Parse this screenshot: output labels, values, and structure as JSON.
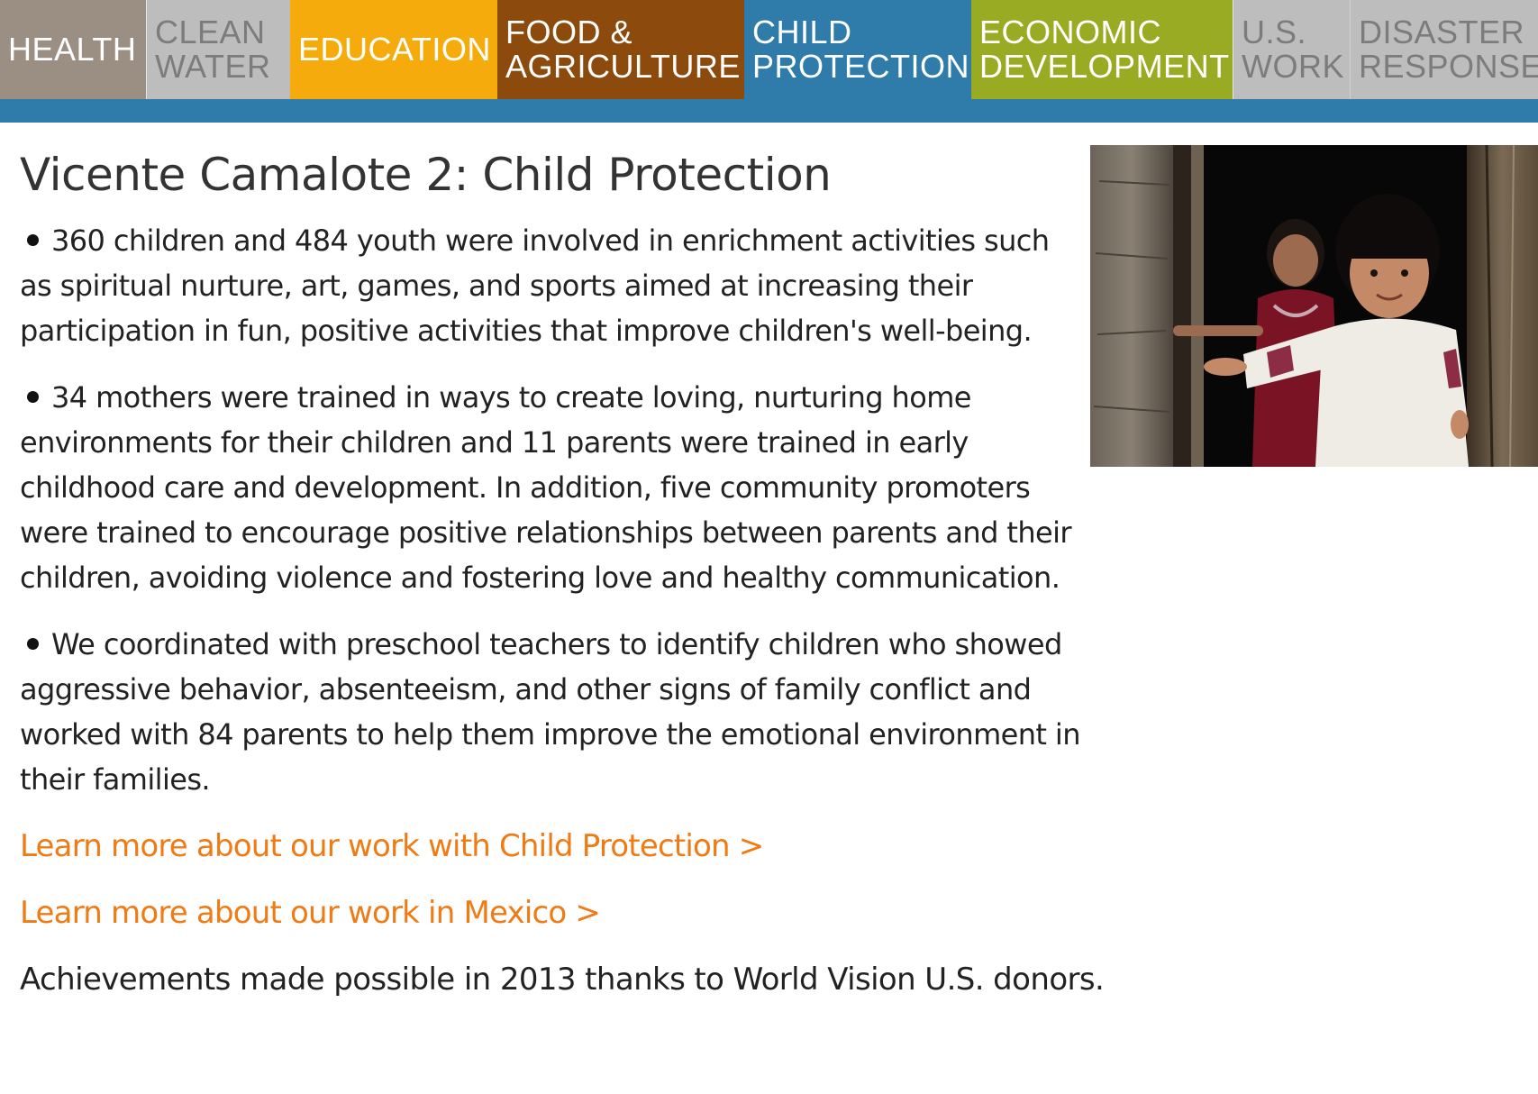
{
  "nav": {
    "tabs": [
      {
        "id": "health",
        "lines": [
          "HEALTH"
        ],
        "bg": "#9b8f83",
        "fg": "#ffffff"
      },
      {
        "id": "water",
        "lines": [
          "CLEAN",
          "WATER"
        ],
        "bg": "#bdbdbd",
        "fg": "#7c7c7c"
      },
      {
        "id": "education",
        "lines": [
          "EDUCATION"
        ],
        "bg": "#f6ab0c",
        "fg": "#ffffff"
      },
      {
        "id": "food",
        "lines": [
          "FOOD &",
          "AGRICULTURE"
        ],
        "bg": "#8c4a0d",
        "fg": "#ffffff"
      },
      {
        "id": "child",
        "lines": [
          "CHILD",
          "PROTECTION"
        ],
        "bg": "#2f7cab",
        "fg": "#ffffff"
      },
      {
        "id": "economic",
        "lines": [
          "ECONOMIC",
          "DEVELOPMENT"
        ],
        "bg": "#99ab23",
        "fg": "#ffffff"
      },
      {
        "id": "us",
        "lines": [
          "U.S.",
          "WORK"
        ],
        "bg": "#bdbdbd",
        "fg": "#7c7c7c"
      },
      {
        "id": "disaster",
        "lines": [
          "DISASTER",
          "RESPONSE"
        ],
        "bg": "#bdbdbd",
        "fg": "#7c7c7c"
      }
    ]
  },
  "colors": {
    "accent_bar": "#2f7cab",
    "link": "#f07b14",
    "text": "#222222"
  },
  "main": {
    "title": "Vicente Camalote 2: Child Protection",
    "paragraphs": [
      "360 children and 484 youth were involved in enrichment activities such as spiritual nurture, art, games, and sports aimed at increasing their participation in fun, positive activities that improve children's well-being.",
      "34 mothers were trained in ways to create loving, nurturing home environments for their children and 11 parents were trained in early childhood care and development. In addition, five community promoters were trained to encourage positive relationships between parents and their children, avoiding violence and fostering love and healthy communication.",
      "We coordinated with preschool teachers to identify children who showed aggressive behavior, absenteeism, and other signs of family conflict and worked with 84 parents to help them improve the emotional environment in their families."
    ],
    "links": {
      "child_protection": "Learn more about our work with Child Protection >",
      "mexico": "Learn more about our work in Mexico >"
    },
    "note": "Achievements made possible in 2013 thanks to World Vision U.S. donors."
  }
}
